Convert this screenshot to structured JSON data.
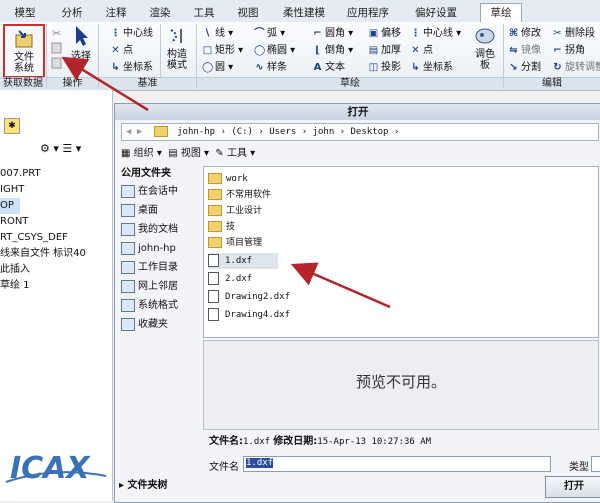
{
  "ribbon_tabs": [
    "模型",
    "分析",
    "注释",
    "渲染",
    "工具",
    "视图",
    "柔性建模",
    "应用程序",
    "偏好设置",
    "草绘"
  ],
  "ribbon": {
    "file_system": "文件\n系统",
    "select": "选择",
    "construct_mode": "构造\n模式",
    "palette": "调色\n板",
    "sketch_items": [
      [
        "线",
        "弧",
        "圆角",
        "偏移",
        "中心线"
      ],
      [
        "矩形",
        "椭圆",
        "倒角",
        "加厚",
        "点"
      ],
      [
        "圆",
        "样条",
        "文本",
        "投影",
        "坐标系"
      ]
    ],
    "ops_items": [
      "中心线",
      "点",
      "坐标系"
    ],
    "edit_items": [
      [
        "修改",
        "删除段"
      ],
      [
        "镜像",
        "拐角"
      ],
      [
        "分割",
        "旋转调整"
      ]
    ],
    "groups": [
      "获取数据",
      "操作",
      "基准",
      "草绘",
      "编辑"
    ]
  },
  "left_tree": [
    "007.PRT",
    "IGHT",
    "OP",
    "RONT",
    "RT_CSYS_DEF",
    "线来自文件 标识40",
    "此插入",
    "草绘 1"
  ],
  "dialog": {
    "title": "打开",
    "address": "john-hp  ›  (C:)  ›  Users  ›  john  ›  Desktop  ›",
    "toolbar": [
      "组织",
      "视图",
      "工具"
    ],
    "sidebar_head": "公用文件夹",
    "sidebar": [
      "在会话中",
      "桌面",
      "我的文档",
      "john-hp",
      "工作目录",
      "网上邻居",
      "系统格式",
      "收藏夹"
    ],
    "folders": [
      "work",
      "不常用软件",
      "工业设计",
      "技",
      "项目管理"
    ],
    "files": [
      "1.dxf",
      "2.dxf",
      "Drawing2.dxf",
      "Drawing4.dxf"
    ],
    "preview_msg": "预览不可用。",
    "fileinfo_label": "文件名:",
    "fileinfo_value": "1.dxf",
    "modified_label": "修改日期:",
    "modified_value": "15-Apr-13 10:27:36 AM",
    "filename_label": "文件名",
    "filename_value": "1.dxf",
    "type_label": "类型",
    "folder_tree": "文件夹树",
    "open_button": "打开"
  },
  "colors": {
    "arrow": "#b4252b",
    "highlight": "#c9302c",
    "accent": "#1a3f8a"
  }
}
